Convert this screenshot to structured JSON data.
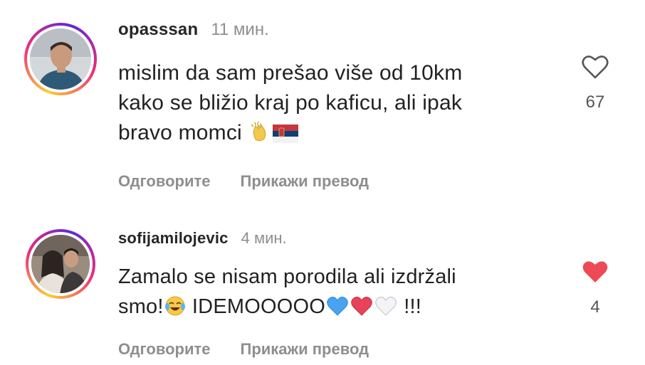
{
  "comments": [
    {
      "username": "opasssan",
      "time": "11 мин.",
      "text_line1": "mislim da sam prešao više od 10km",
      "text_line2": "kako se bližio kraj po kaficu, ali ipak",
      "text_line3": "bravo momci",
      "like_count": "67",
      "liked": false,
      "reply_label": "Одговорите",
      "translate_label": "Прикажи превод",
      "emojis": [
        "clapping-hands",
        "serbia-flag"
      ]
    },
    {
      "username": "sofijamilojevic",
      "time": "4 мин.",
      "text_line1": "Zamalo se nisam porodila ali izdržali",
      "text_line2_a": "smo!",
      "text_line2_b": " IDEMOOOOO",
      "text_line2_c": " !!!",
      "like_count": "4",
      "liked": true,
      "reply_label": "Одговорите",
      "translate_label": "Прикажи превод",
      "emojis": [
        "tears-of-joy",
        "blue-heart",
        "red-heart",
        "white-heart"
      ]
    }
  ],
  "colors": {
    "liked_heart": "#ed4956",
    "secondary_text": "#8e8e8e"
  }
}
